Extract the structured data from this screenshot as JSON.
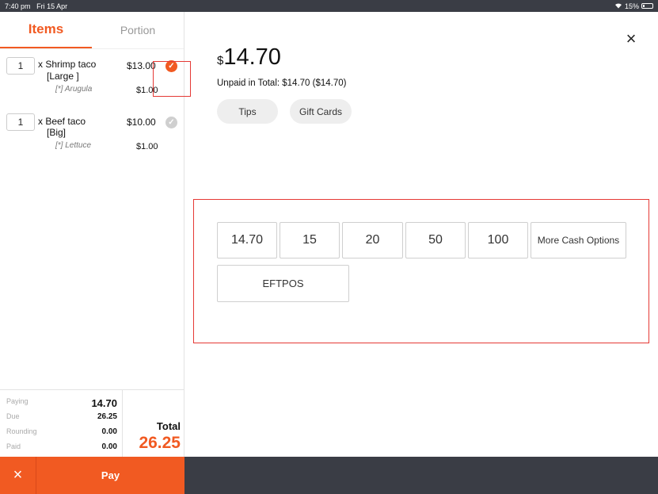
{
  "status": {
    "time": "7:40 pm",
    "date": "Fri 15 Apr",
    "battery": "15%",
    "wifi_icon": "wifi-icon"
  },
  "tabs": [
    {
      "label": "Items"
    },
    {
      "label": "Portion"
    }
  ],
  "items": [
    {
      "qty": "1",
      "name": "x Shrimp taco",
      "size": "[Large ]",
      "price": "$13.00",
      "modifier": "[*] Arugula",
      "modifier_price": "$1.00",
      "checked": true
    },
    {
      "qty": "1",
      "name": "x Beef taco",
      "size": "[Big]",
      "price": "$10.00",
      "modifier": "[*] Lettuce",
      "modifier_price": "$1.00",
      "checked": false
    }
  ],
  "summary": {
    "paying_label": "Paying",
    "paying": "14.70",
    "due_label": "Due",
    "due": "26.25",
    "rounding_label": "Rounding",
    "rounding": "0.00",
    "paid_label": "Paid",
    "paid": "0.00",
    "total_label": "Total",
    "total": "26.25"
  },
  "footer": {
    "cancel_icon": "×",
    "pay_label": "Pay"
  },
  "payment": {
    "close_icon": "×",
    "currency": "$",
    "amount": "14.70",
    "unpaid": "Unpaid in Total: $14.70 ($14.70)",
    "tips_label": "Tips",
    "giftcards_label": "Gift Cards",
    "cash_options": [
      "14.70",
      "15",
      "20",
      "50",
      "100"
    ],
    "more_cash_label": "More Cash Options",
    "eftpos_label": "EFTPOS"
  },
  "colors": {
    "accent": "#f15a22",
    "highlight": "#e53935",
    "bar": "#3a3d45"
  }
}
